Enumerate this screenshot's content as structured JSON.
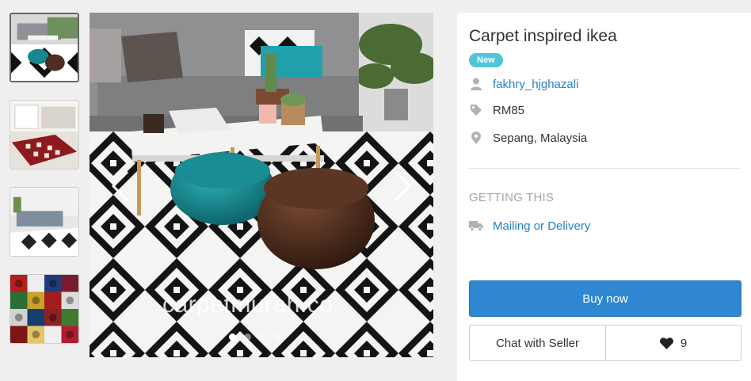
{
  "listing": {
    "title": "Carpet inspired ikea",
    "condition_badge": "New",
    "seller": "fakhry_hjghazali",
    "price": "RM85",
    "location": "Sepang, Malaysia"
  },
  "gallery": {
    "watermark": "carpetmurah.co",
    "thumbnail_count": 4,
    "active_index": 0,
    "slide_count": 4
  },
  "getting_this": {
    "heading": "GETTING THIS",
    "method": "Mailing or Delivery"
  },
  "actions": {
    "buy_label": "Buy now",
    "chat_label": "Chat with Seller",
    "like_count": "9"
  },
  "colors": {
    "accent_blue": "#2f87d1",
    "link_blue": "#2a7fc4",
    "badge_teal": "#4ec5d8",
    "muted_gray": "#a5a5a5"
  },
  "icons": [
    "user-icon",
    "price-tag-icon",
    "location-pin-icon",
    "truck-icon",
    "heart-icon",
    "chevron-left-icon",
    "chevron-right-icon"
  ]
}
